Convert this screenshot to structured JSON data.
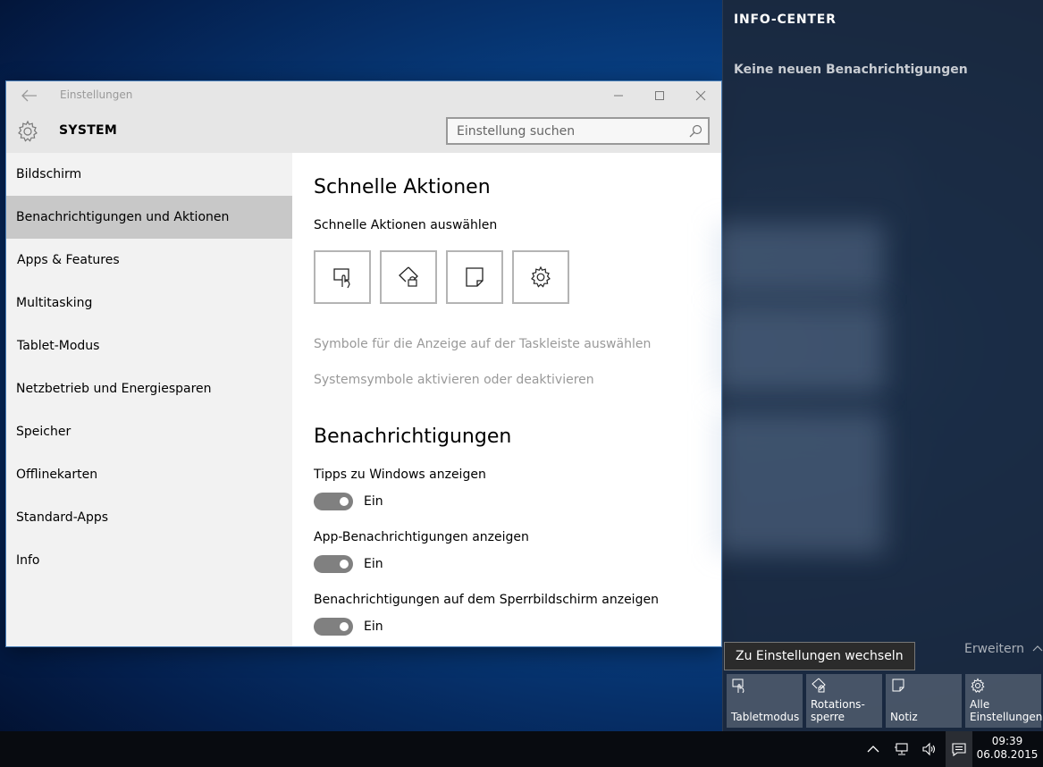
{
  "window": {
    "title": "Einstellungen",
    "section_title": "SYSTEM",
    "search_placeholder": "Einstellung suchen"
  },
  "sidebar": {
    "items": [
      {
        "label": "Bildschirm",
        "active": false
      },
      {
        "label": "Benachrichtigungen und Aktionen",
        "active": true
      },
      {
        "label": "Apps & Features",
        "active": false
      },
      {
        "label": "Multitasking",
        "active": false
      },
      {
        "label": "Tablet-Modus",
        "active": false
      },
      {
        "label": "Netzbetrieb und Energiesparen",
        "active": false
      },
      {
        "label": "Speicher",
        "active": false
      },
      {
        "label": "Offlinekarten",
        "active": false
      },
      {
        "label": "Standard-Apps",
        "active": false
      },
      {
        "label": "Info",
        "active": false
      }
    ]
  },
  "content": {
    "quick_actions_heading": "Schnelle Aktionen",
    "quick_actions_subtitle": "Schnelle Aktionen auswählen",
    "quick_action_icons": [
      "tablet-mode-icon",
      "rotation-lock-icon",
      "note-icon",
      "gear-icon"
    ],
    "link_taskbar_icons": "Symbole für die Anzeige auf der Taskleiste auswählen",
    "link_system_icons": "Systemsymbole aktivieren oder deaktivieren",
    "notifications_heading": "Benachrichtigungen",
    "toggles": [
      {
        "label": "Tipps zu Windows anzeigen",
        "state": "Ein",
        "on": true
      },
      {
        "label": "App-Benachrichtigungen anzeigen",
        "state": "Ein",
        "on": true
      },
      {
        "label": "Benachrichtigungen auf dem Sperrbildschirm anzeigen",
        "state": "Ein",
        "on": true
      }
    ]
  },
  "action_center": {
    "title": "INFO-CENTER",
    "empty_text": "Keine neuen Benachrichtigungen",
    "expand_label": "Erweitern",
    "tooltip": "Zu Einstellungen wechseln",
    "tiles": [
      {
        "line1": "Tabletmodus",
        "line2": "",
        "icon": "tablet-mode-icon"
      },
      {
        "line1": "Rotations-",
        "line2": "sperre",
        "icon": "rotation-lock-icon"
      },
      {
        "line1": "Notiz",
        "line2": "",
        "icon": "note-icon"
      },
      {
        "line1": "Alle",
        "line2": "Einstellungen",
        "icon": "gear-icon"
      }
    ]
  },
  "taskbar": {
    "time": "09:39",
    "date": "06.08.2015"
  },
  "colors": {
    "toggle_on": "#808080",
    "sidebar_active": "#c8c8c8",
    "titlebar": "#e6e6e6"
  }
}
